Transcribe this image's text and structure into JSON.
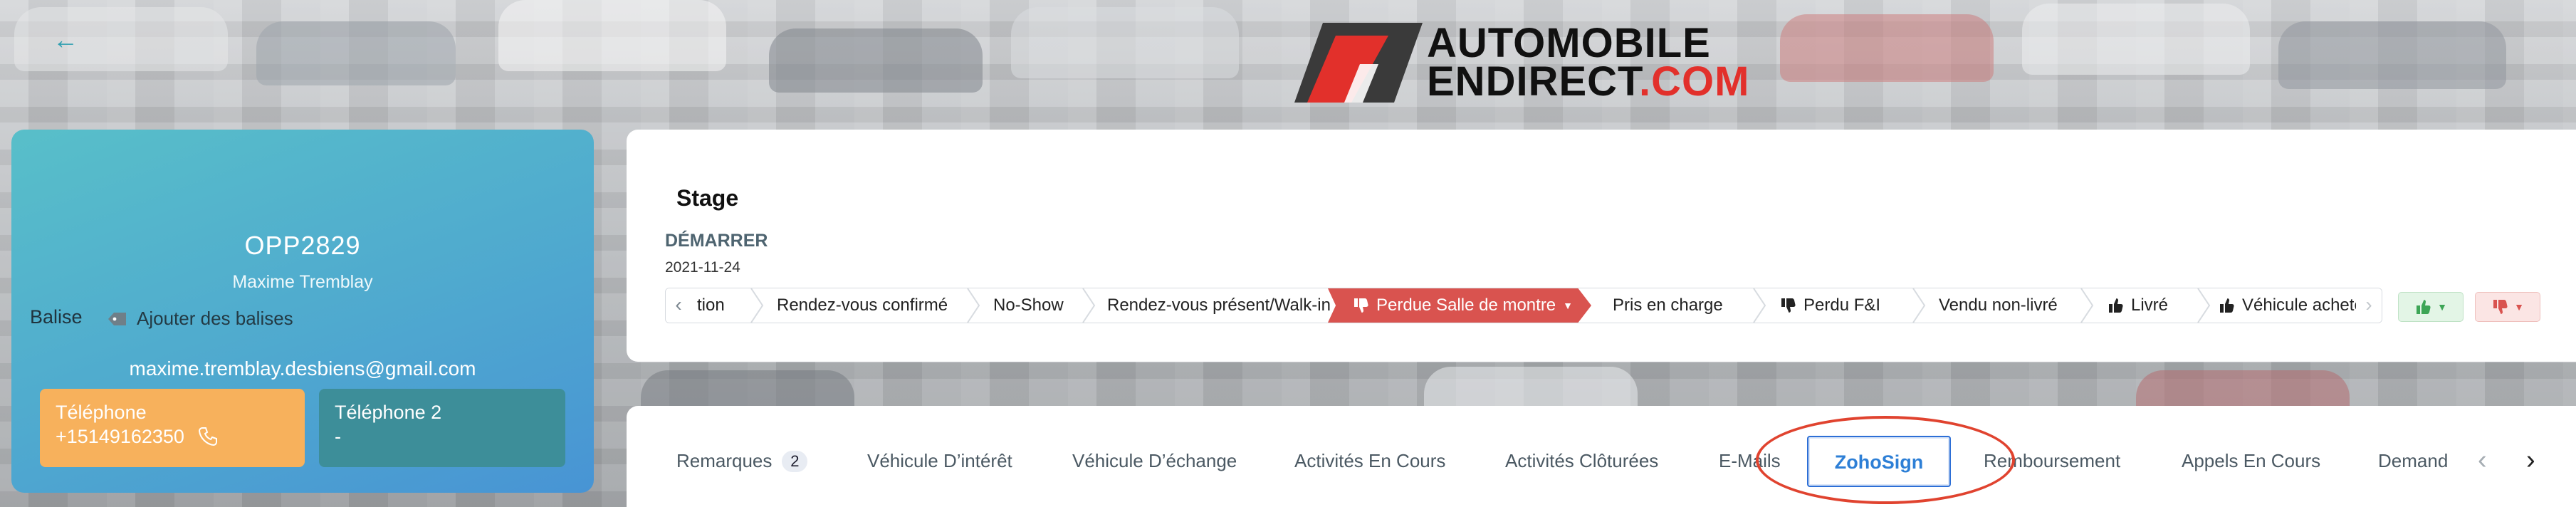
{
  "brand": {
    "logo_line1": "AUTOMOBILE",
    "logo_line2_a": "ENDIRECT",
    "logo_line2_b": ".COM",
    "accent": "#e2302b"
  },
  "header": {
    "back_icon": "arrow-left-icon"
  },
  "opportunity": {
    "id": "OPP2829",
    "owner": "Maxime Tremblay",
    "tag_label": "Balise",
    "add_tags": "Ajouter des balises",
    "email": "maxime.tremblay.desbiens@gmail.com",
    "phone1_label": "Téléphone",
    "phone1_value": "+15149162350",
    "phone2_label": "Téléphone 2",
    "phone2_value": "-"
  },
  "stage": {
    "title": "Stage",
    "start_label": "DÉMARRER",
    "start_date": "2021-11-24",
    "steps": [
      {
        "label": "tion"
      },
      {
        "label": "Rendez-vous confirmé"
      },
      {
        "label": "No-Show"
      },
      {
        "label": "Rendez-vous présent/Walk-in"
      },
      {
        "label": "Perdue Salle de montre",
        "active": true
      },
      {
        "label": "Pris en charge"
      },
      {
        "label": "Perdu F&I"
      },
      {
        "label": "Vendu non-livré"
      },
      {
        "label": "Livré"
      },
      {
        "label": "Véhicule acheté"
      }
    ],
    "active_color": "#d9534f"
  },
  "tabs": [
    {
      "label": "Remarques",
      "count": "2"
    },
    {
      "label": "Véhicule D’intérêt"
    },
    {
      "label": "Véhicule D’échange"
    },
    {
      "label": "Activités En Cours"
    },
    {
      "label": "Activités Clôturées"
    },
    {
      "label": "E-Mails"
    },
    {
      "label": "ZohoSign",
      "active": true
    },
    {
      "label": "Remboursement"
    },
    {
      "label": "Appels En Cours"
    },
    {
      "label": "Demand"
    }
  ]
}
